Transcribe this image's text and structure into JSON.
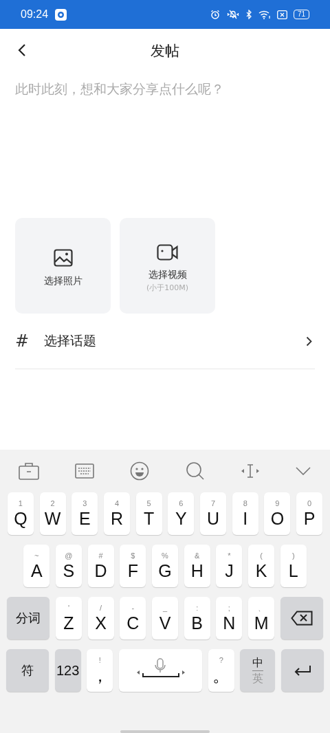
{
  "status_bar": {
    "time": "09:24",
    "battery": "71"
  },
  "header": {
    "title": "发帖"
  },
  "post_field": {
    "placeholder": "此时此刻，想和大家分享点什么呢？"
  },
  "media_buttons": [
    {
      "kind": "photo",
      "label": "选择照片"
    },
    {
      "kind": "video",
      "label": "选择视频",
      "note": "(小于100M)"
    }
  ],
  "topic_row": {
    "symbol": "#",
    "label": "选择话题"
  },
  "keyboard": {
    "key_lines": [
      {
        "keys": [
          {
            "kind": "letter",
            "main": "Q",
            "sub": "1"
          },
          {
            "kind": "letter",
            "main": "W",
            "sub": "2"
          },
          {
            "kind": "letter",
            "main": "E",
            "sub": "3"
          },
          {
            "kind": "letter",
            "main": "R",
            "sub": "4"
          },
          {
            "kind": "letter",
            "main": "T",
            "sub": "5"
          },
          {
            "kind": "letter",
            "main": "Y",
            "sub": "6"
          },
          {
            "kind": "letter",
            "main": "U",
            "sub": "7"
          },
          {
            "kind": "letter",
            "main": "I",
            "sub": "8"
          },
          {
            "kind": "letter",
            "main": "O",
            "sub": "9"
          },
          {
            "kind": "letter",
            "main": "P",
            "sub": "0"
          }
        ]
      },
      {
        "keys": [
          {
            "kind": "letter",
            "main": "A",
            "sub": "~"
          },
          {
            "kind": "letter",
            "main": "S",
            "sub": "@"
          },
          {
            "kind": "letter",
            "main": "D",
            "sub": "#"
          },
          {
            "kind": "letter",
            "main": "F",
            "sub": "$"
          },
          {
            "kind": "letter",
            "main": "G",
            "sub": "%"
          },
          {
            "kind": "letter",
            "main": "H",
            "sub": "&"
          },
          {
            "kind": "letter",
            "main": "J",
            "sub": "*"
          },
          {
            "kind": "letter",
            "main": "K",
            "sub": "("
          },
          {
            "kind": "letter",
            "main": "L",
            "sub": ")"
          }
        ]
      },
      {
        "keys": [
          {
            "kind": "wide-fn",
            "main": "分词"
          },
          {
            "kind": "letter",
            "main": "Z",
            "sub": "'"
          },
          {
            "kind": "letter",
            "main": "X",
            "sub": "/"
          },
          {
            "kind": "letter",
            "main": "C",
            "sub": "-"
          },
          {
            "kind": "letter",
            "main": "V",
            "sub": "_"
          },
          {
            "kind": "letter",
            "main": "B",
            "sub": ":"
          },
          {
            "kind": "letter",
            "main": "N",
            "sub": ";"
          },
          {
            "kind": "letter",
            "main": "M",
            "sub": "、"
          },
          {
            "kind": "backspace"
          }
        ]
      },
      {
        "keys": [
          {
            "kind": "wide-fn",
            "main": "符"
          },
          {
            "kind": "fn",
            "main": "123"
          },
          {
            "kind": "letter",
            "main": "，",
            "sub": "!"
          },
          {
            "kind": "space"
          },
          {
            "kind": "letter",
            "main": "。",
            "sub": "?"
          },
          {
            "kind": "lang",
            "main": "中",
            "sub": "英"
          },
          {
            "kind": "enter"
          }
        ]
      }
    ]
  }
}
